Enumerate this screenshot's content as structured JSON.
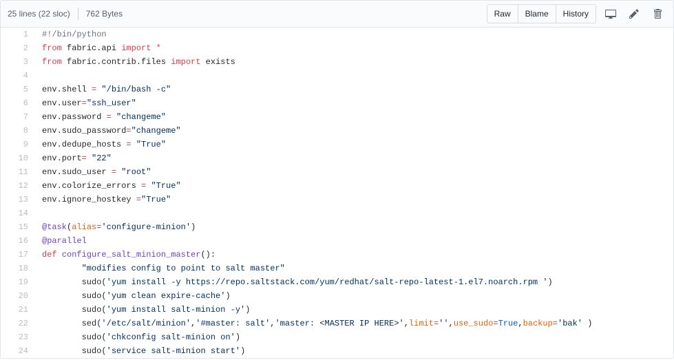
{
  "header": {
    "lines_text": "25 lines (22 sloc)",
    "size_text": "762 Bytes",
    "buttons": {
      "raw": "Raw",
      "blame": "Blame",
      "history": "History"
    }
  },
  "code": {
    "lines": [
      {
        "n": 1,
        "segs": [
          {
            "c": "pl-c",
            "t": "#!/bin/python"
          }
        ]
      },
      {
        "n": 2,
        "segs": [
          {
            "c": "pl-k",
            "t": "from"
          },
          {
            "t": " fabric.api "
          },
          {
            "c": "pl-k",
            "t": "import"
          },
          {
            "t": " "
          },
          {
            "c": "pl-k",
            "t": "*"
          }
        ]
      },
      {
        "n": 3,
        "segs": [
          {
            "c": "pl-k",
            "t": "from"
          },
          {
            "t": " fabric.contrib.files "
          },
          {
            "c": "pl-k",
            "t": "import"
          },
          {
            "t": " exists"
          }
        ]
      },
      {
        "n": 4,
        "segs": []
      },
      {
        "n": 5,
        "segs": [
          {
            "t": "env.shell "
          },
          {
            "c": "pl-k",
            "t": "="
          },
          {
            "t": " "
          },
          {
            "c": "pl-s",
            "t": "\"/bin/bash -c\""
          }
        ]
      },
      {
        "n": 6,
        "segs": [
          {
            "t": "env.user"
          },
          {
            "c": "pl-k",
            "t": "="
          },
          {
            "c": "pl-s",
            "t": "\"ssh_user\""
          }
        ]
      },
      {
        "n": 7,
        "segs": [
          {
            "t": "env.password "
          },
          {
            "c": "pl-k",
            "t": "="
          },
          {
            "t": " "
          },
          {
            "c": "pl-s",
            "t": "\"changeme\""
          }
        ]
      },
      {
        "n": 8,
        "segs": [
          {
            "t": "env.sudo_password"
          },
          {
            "c": "pl-k",
            "t": "="
          },
          {
            "c": "pl-s",
            "t": "\"changeme\""
          }
        ]
      },
      {
        "n": 9,
        "segs": [
          {
            "t": "env.dedupe_hosts "
          },
          {
            "c": "pl-k",
            "t": "="
          },
          {
            "t": " "
          },
          {
            "c": "pl-s",
            "t": "\"True\""
          }
        ]
      },
      {
        "n": 10,
        "segs": [
          {
            "t": "env.port"
          },
          {
            "c": "pl-k",
            "t": "="
          },
          {
            "t": " "
          },
          {
            "c": "pl-s",
            "t": "\"22\""
          }
        ]
      },
      {
        "n": 11,
        "segs": [
          {
            "t": "env.sudo_user "
          },
          {
            "c": "pl-k",
            "t": "="
          },
          {
            "t": " "
          },
          {
            "c": "pl-s",
            "t": "\"root\""
          }
        ]
      },
      {
        "n": 12,
        "segs": [
          {
            "t": "env.colorize_errors "
          },
          {
            "c": "pl-k",
            "t": "="
          },
          {
            "t": " "
          },
          {
            "c": "pl-s",
            "t": "\"True\""
          }
        ]
      },
      {
        "n": 13,
        "segs": [
          {
            "t": "env.ignore_hostkey "
          },
          {
            "c": "pl-k",
            "t": "="
          },
          {
            "c": "pl-s",
            "t": "\"True\""
          }
        ]
      },
      {
        "n": 14,
        "segs": []
      },
      {
        "n": 15,
        "segs": [
          {
            "c": "pl-en",
            "t": "@task"
          },
          {
            "t": "("
          },
          {
            "c": "pl-v",
            "t": "alias"
          },
          {
            "c": "pl-k",
            "t": "="
          },
          {
            "c": "pl-s",
            "t": "'configure-minion'"
          },
          {
            "t": ")"
          }
        ]
      },
      {
        "n": 16,
        "segs": [
          {
            "c": "pl-en",
            "t": "@parallel"
          }
        ]
      },
      {
        "n": 17,
        "segs": [
          {
            "c": "pl-k",
            "t": "def"
          },
          {
            "t": " "
          },
          {
            "c": "pl-en",
            "t": "configure_salt_minion_master"
          },
          {
            "t": "():"
          }
        ]
      },
      {
        "n": 18,
        "segs": [
          {
            "t": "        "
          },
          {
            "c": "pl-s",
            "t": "\"modifies config to point to salt master\""
          }
        ]
      },
      {
        "n": 19,
        "segs": [
          {
            "t": "        sudo("
          },
          {
            "c": "pl-s",
            "t": "'yum install -y https://repo.saltstack.com/yum/redhat/salt-repo-latest-1.el7.noarch.rpm '"
          },
          {
            "t": ")"
          }
        ]
      },
      {
        "n": 20,
        "segs": [
          {
            "t": "        sudo("
          },
          {
            "c": "pl-s",
            "t": "'yum clean expire-cache'"
          },
          {
            "t": ")"
          }
        ]
      },
      {
        "n": 21,
        "segs": [
          {
            "t": "        sudo("
          },
          {
            "c": "pl-s",
            "t": "'yum install salt-minion -y'"
          },
          {
            "t": ")"
          }
        ]
      },
      {
        "n": 22,
        "segs": [
          {
            "t": "        sed("
          },
          {
            "c": "pl-s",
            "t": "'/etc/salt/minion'"
          },
          {
            "t": ","
          },
          {
            "c": "pl-s",
            "t": "'#master: salt'"
          },
          {
            "t": ","
          },
          {
            "c": "pl-s",
            "t": "'master: <MASTER IP HERE>'"
          },
          {
            "t": ","
          },
          {
            "c": "pl-v",
            "t": "limit"
          },
          {
            "c": "pl-k",
            "t": "="
          },
          {
            "c": "pl-s",
            "t": "''"
          },
          {
            "t": ","
          },
          {
            "c": "pl-v",
            "t": "use_sudo"
          },
          {
            "c": "pl-k",
            "t": "="
          },
          {
            "c": "pl-c1",
            "t": "True"
          },
          {
            "t": ","
          },
          {
            "c": "pl-v",
            "t": "backup"
          },
          {
            "c": "pl-k",
            "t": "="
          },
          {
            "c": "pl-s",
            "t": "'bak'"
          },
          {
            "t": " )"
          }
        ]
      },
      {
        "n": 23,
        "segs": [
          {
            "t": "        sudo("
          },
          {
            "c": "pl-s",
            "t": "'chkconfig salt-minion on'"
          },
          {
            "t": ")"
          }
        ]
      },
      {
        "n": 24,
        "segs": [
          {
            "t": "        sudo("
          },
          {
            "c": "pl-s",
            "t": "'service salt-minion start'"
          },
          {
            "t": ")"
          }
        ]
      }
    ]
  }
}
